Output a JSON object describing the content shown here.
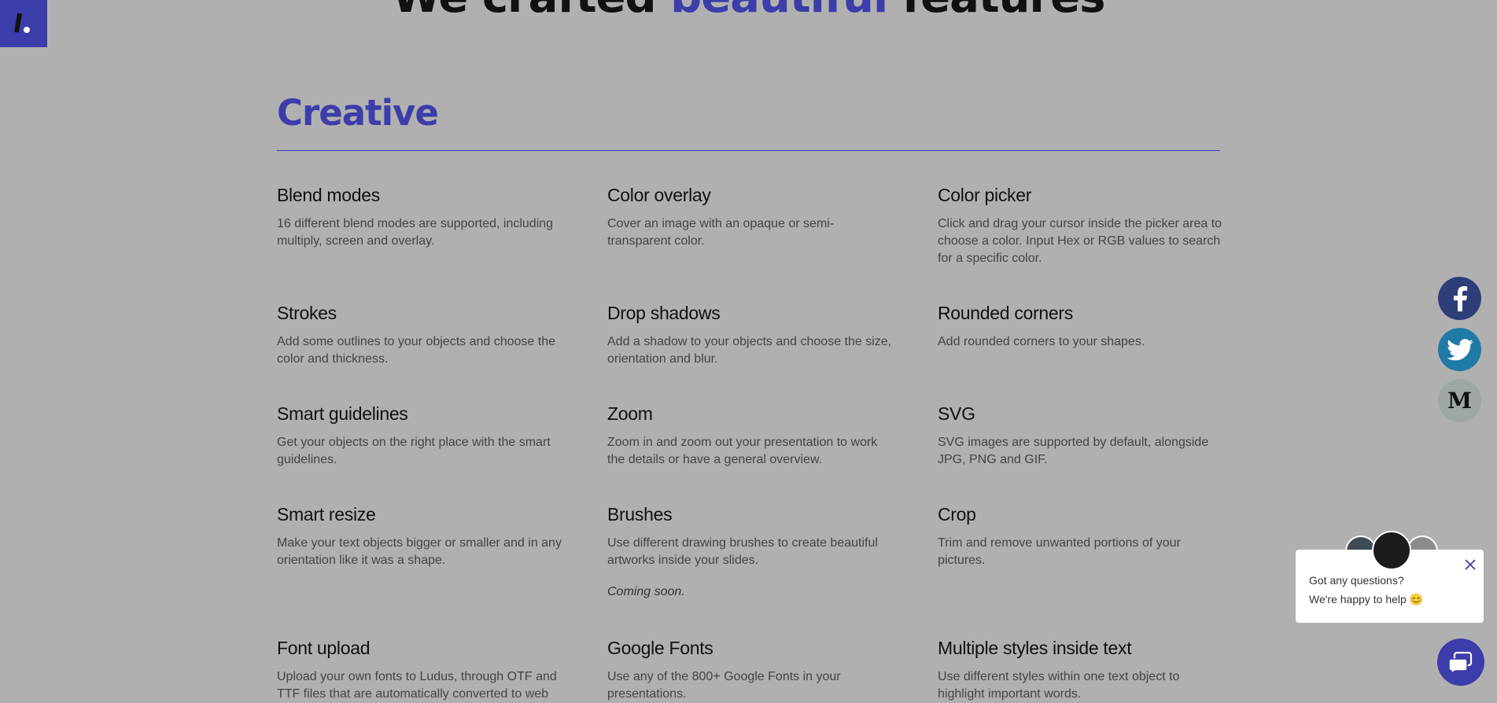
{
  "hero": {
    "title_prefix": "We crafted ",
    "title_accent": "beautiful",
    "title_suffix": " features"
  },
  "section": {
    "title": "Creative"
  },
  "features": [
    {
      "title": "Blend modes",
      "desc": "16 different blend modes are supported, including multiply, screen and overlay."
    },
    {
      "title": "Color overlay",
      "desc": "Cover an image with an opaque or semi-transparent color."
    },
    {
      "title": "Color picker",
      "desc": "Click and drag your cursor inside the picker area to choose a color. Input Hex or RGB values to search for a specific color."
    },
    {
      "title": "Strokes",
      "desc": "Add some outlines to your objects and choose the color and thickness."
    },
    {
      "title": "Drop shadows",
      "desc": "Add a shadow to your objects and choose the size, orientation and blur."
    },
    {
      "title": "Rounded corners",
      "desc": "Add rounded corners to your shapes."
    },
    {
      "title": "Smart guidelines",
      "desc": "Get your objects on the right place with the smart guidelines."
    },
    {
      "title": "Zoom",
      "desc": "Zoom in and zoom out your presentation to work the details or have a general overview."
    },
    {
      "title": "SVG",
      "desc": "SVG images are supported by default, alongside JPG, PNG and GIF."
    },
    {
      "title": "Smart resize",
      "desc": "Make your text objects bigger or smaller and in any orientation like it was a shape."
    },
    {
      "title": "Brushes",
      "desc": "Use different drawing brushes to create beautiful artworks inside your slides.",
      "note": "Coming soon."
    },
    {
      "title": "Crop",
      "desc": "Trim and remove unwanted portions of your pictures."
    },
    {
      "title": "Font upload",
      "desc": "Upload your own fonts to Ludus, through OTF and TTF files that are automatically converted to web"
    },
    {
      "title": "Google Fonts",
      "desc": "Use any of the 800+ Google Fonts in your presentations."
    },
    {
      "title": "Multiple styles inside text",
      "desc": "Use different styles within one text object to highlight important words."
    }
  ],
  "social": {
    "facebook_icon": "facebook-icon",
    "twitter_icon": "twitter-icon",
    "medium_glyph": "M"
  },
  "chat": {
    "line1": "Got any questions?",
    "line2": "We're happy to help 😊"
  },
  "colors": {
    "accent": "#3c3caa",
    "background": "#b0b0b1"
  }
}
